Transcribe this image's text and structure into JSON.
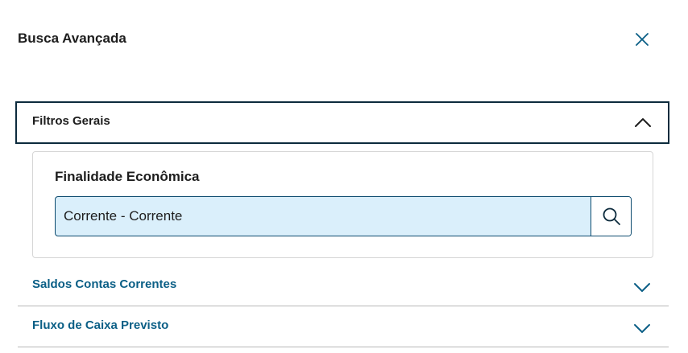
{
  "dialog": {
    "title": "Busca Avançada",
    "close_icon": "close-icon"
  },
  "filters": {
    "label": "Filtros Gerais",
    "expanded": true,
    "chevron_icon": "chevron-up-icon",
    "fields": [
      {
        "label": "Finalidade Econômica",
        "value": "Corrente - Corrente",
        "button_icon": "search-icon"
      }
    ]
  },
  "sections": [
    {
      "label": "Saldos Contas Correntes",
      "expanded": false,
      "chevron_icon": "chevron-down-icon"
    },
    {
      "label": "Fluxo de Caixa Previsto",
      "expanded": false,
      "chevron_icon": "chevron-down-icon"
    }
  ],
  "colors": {
    "accent_dark": "#0c2b3d",
    "link_blue": "#0b5f86",
    "input_bg": "#daeffb"
  }
}
